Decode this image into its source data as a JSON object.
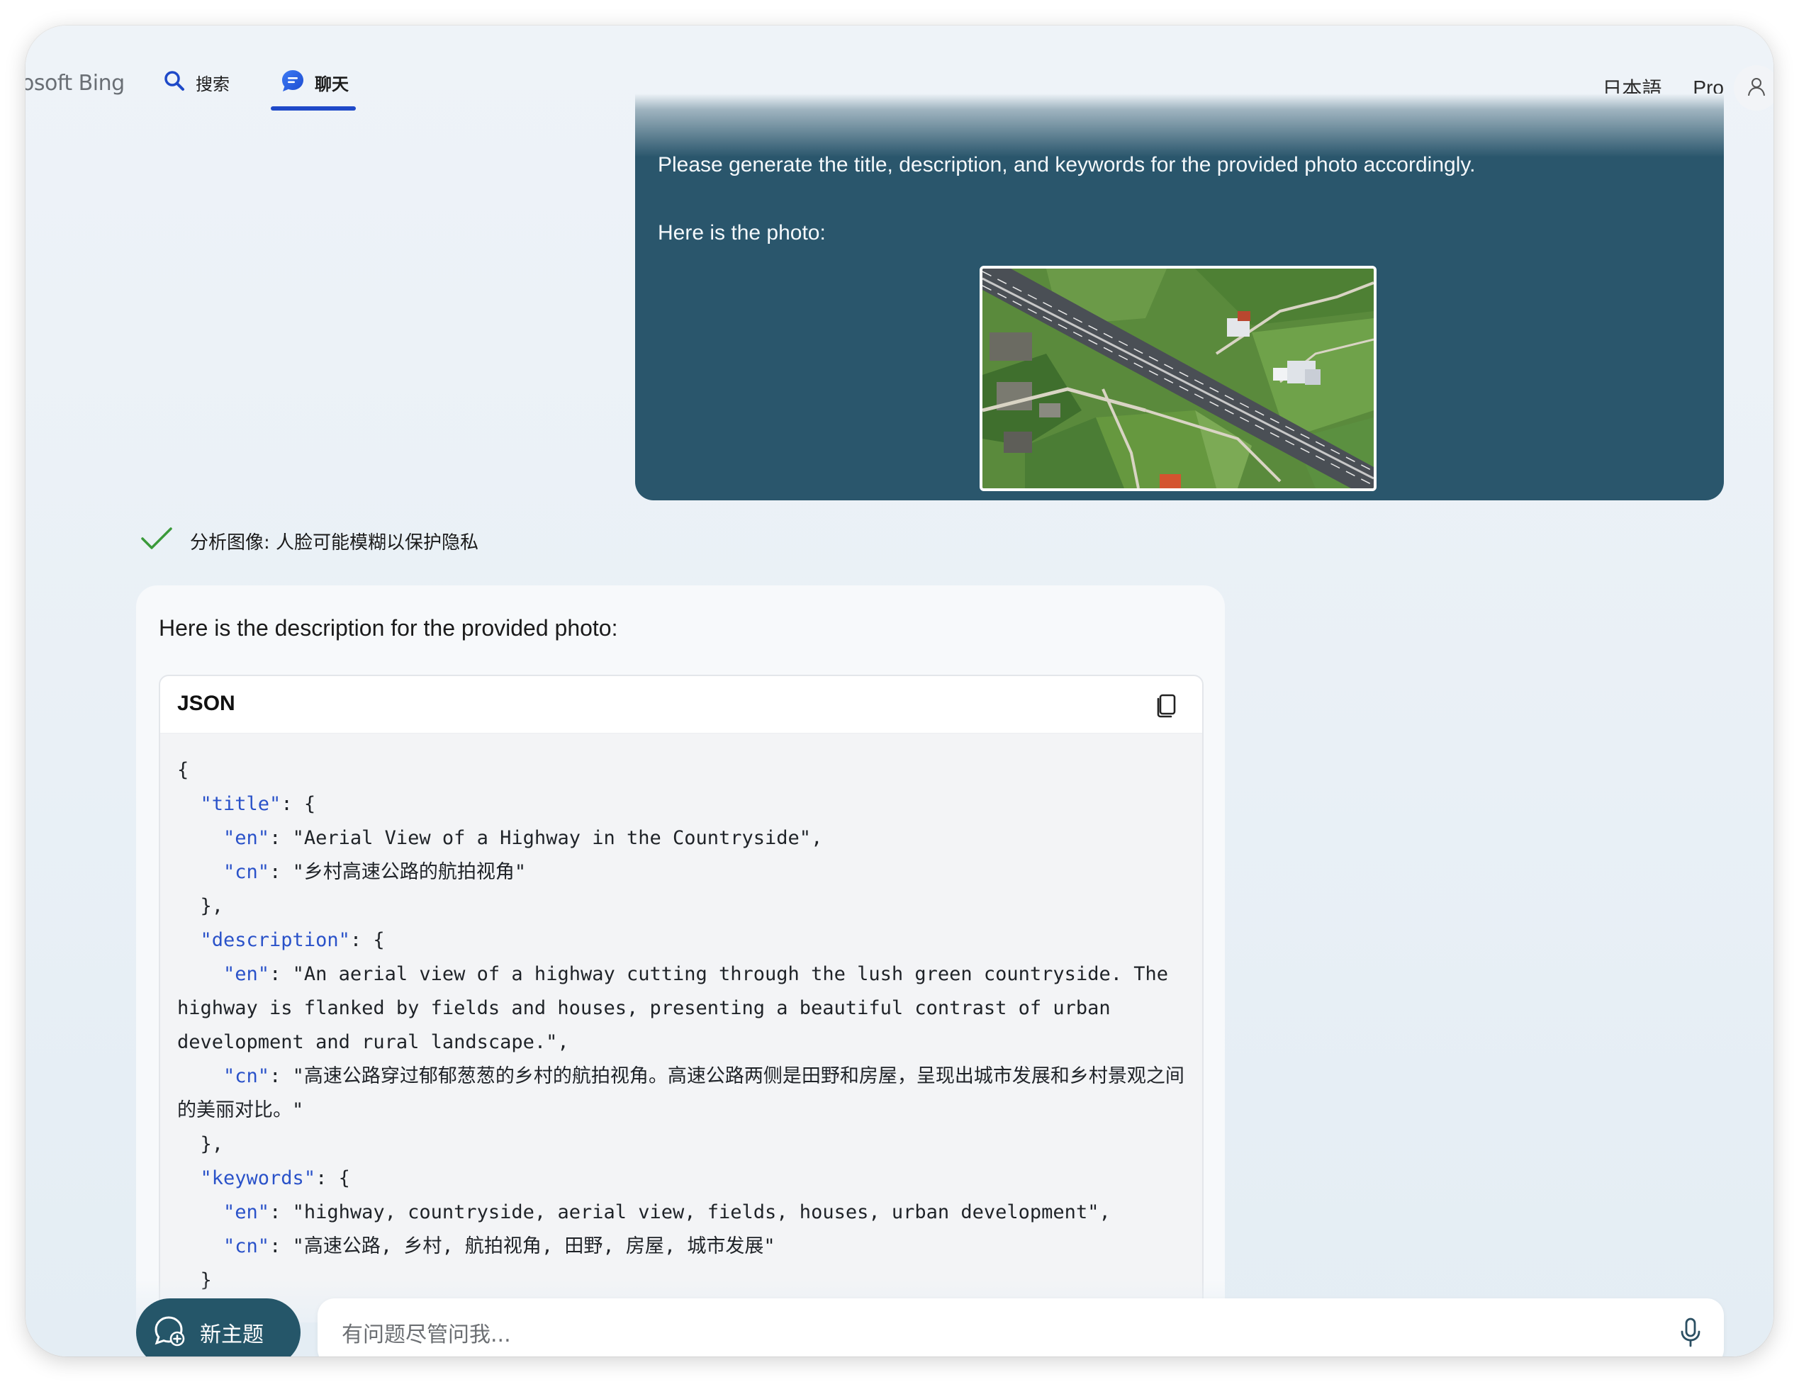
{
  "nav": {
    "brand": "osoft Bing",
    "tabs": [
      {
        "label": "搜索",
        "icon": "search-icon"
      },
      {
        "label": "聊天",
        "icon": "chat-icon",
        "active": true
      }
    ],
    "language": "日本語",
    "pro": "Pro",
    "avatar_icon": "user-icon"
  },
  "user_message": {
    "line1": "Please generate the title, description, and keywords for the provided photo accordingly.",
    "line2": "Here is the photo:"
  },
  "status": {
    "text": "分析图像: 人脸可能模糊以保护隐私",
    "icon": "check-icon"
  },
  "response": {
    "intro": "Here is the description for the provided photo:",
    "code_language": "JSON",
    "copy_icon": "copy-icon",
    "lines": {
      "l1": "{",
      "l2_key": "\"title\"",
      "l2_rest": ": {",
      "l3_key": "\"en\"",
      "l3_rest": ": \"Aerial View of a Highway in the Countryside\",",
      "l4_key": "\"cn\"",
      "l4_rest": ": \"乡村高速公路的航拍视角\"",
      "l5": "},",
      "l6_key": "\"description\"",
      "l6_rest": ": {",
      "l7_key": "\"en\"",
      "l7_rest": ": \"An aerial view of a highway cutting through the lush green countryside. The highway is flanked by fields and houses, presenting a beautiful contrast of urban development and rural landscape.\",",
      "l8_key": "\"cn\"",
      "l8_rest": ": \"高速公路穿过郁郁葱葱的乡村的航拍视角。高速公路两侧是田野和房屋，呈现出城市发展和乡村景观之间的美丽对比。\"",
      "l9": "},",
      "l10_key": "\"keywords\"",
      "l10_rest": ": {",
      "l11_key": "\"en\"",
      "l11_rest": ": \"highway, countryside, aerial view, fields, houses, urban development\",",
      "l12_key": "\"cn\"",
      "l12_rest": ": \"高速公路, 乡村, 航拍视角, 田野, 房屋, 城市发展\"",
      "l13": "}"
    }
  },
  "composer": {
    "new_topic_label": "新主题",
    "placeholder": "有问题尽管问我...",
    "mic_icon": "microphone-icon"
  },
  "colors": {
    "accent": "#1e49c8",
    "user_bubble": "#2a566c",
    "new_topic_button": "#255669",
    "json_key": "#2a52c9",
    "check": "#3a9a3a"
  }
}
